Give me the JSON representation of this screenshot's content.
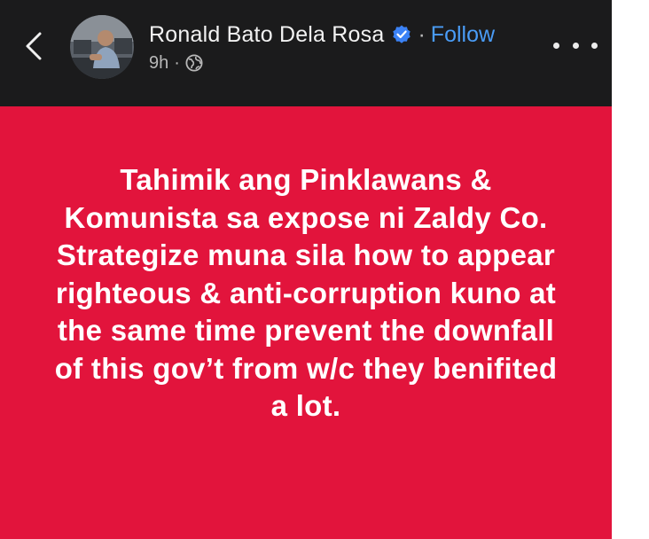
{
  "header": {
    "author_name": "Ronald Bato Dela Rosa",
    "separator": "·",
    "follow_label": "Follow",
    "timestamp": "9h",
    "meta_separator": "·",
    "audience_icon": "globe-icon",
    "back_icon": "chevron-left-icon",
    "more_icon": "more-options-icon",
    "verified_icon": "verified-badge-icon"
  },
  "post": {
    "text": "Tahimik ang Pinklawans & Komunista sa expose ni Zaldy Co. Strategize muna sila how to appear righteous & anti-corruption kuno at the same time prevent the downfall of this gov’t from w/c they benifited a lot.",
    "background_color": "#e2143c",
    "text_color": "#ffffff"
  },
  "colors": {
    "header_bg": "#1b1b1c",
    "follow": "#4a9cf6",
    "verified": "#3b82f6"
  }
}
